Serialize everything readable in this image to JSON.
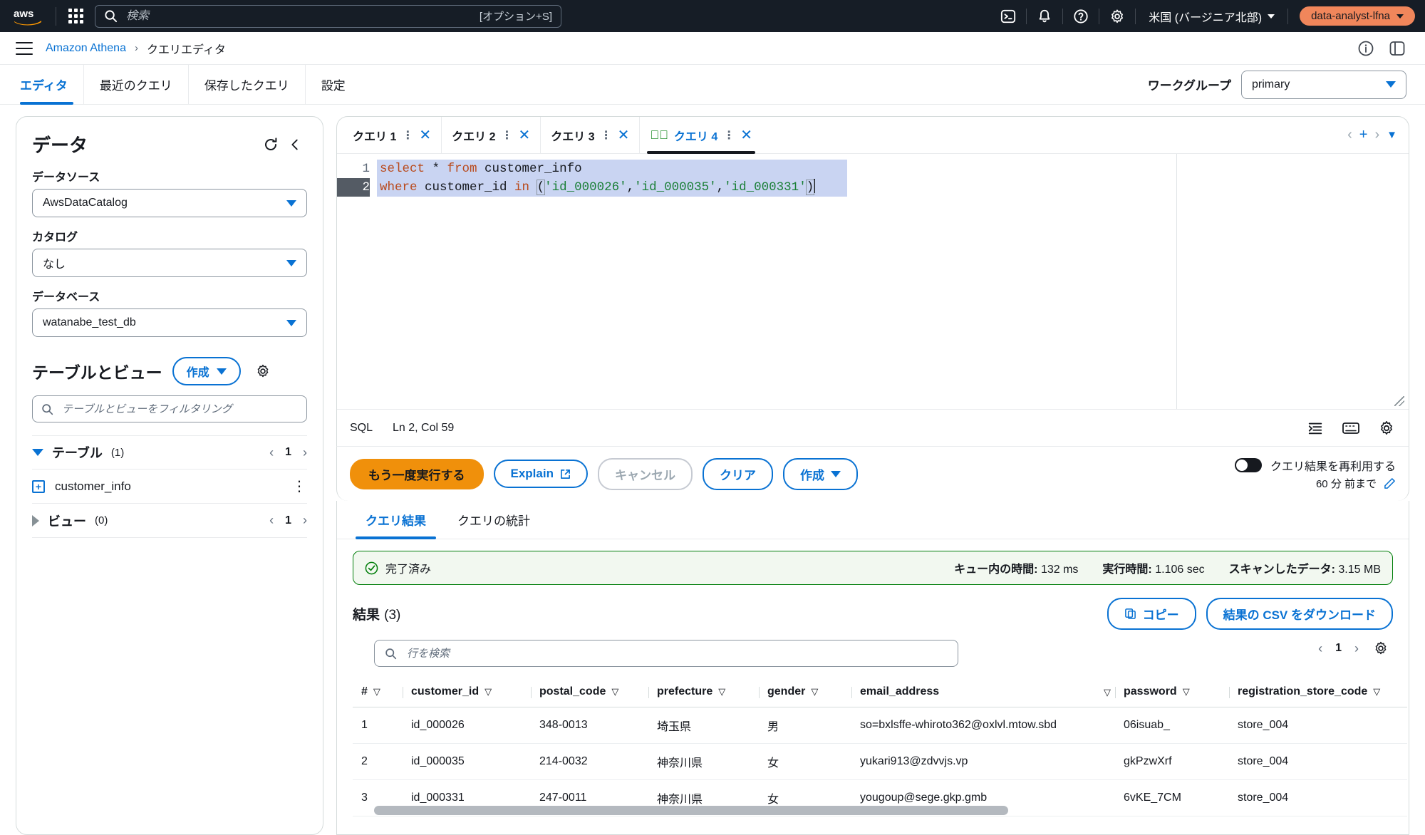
{
  "top_nav": {
    "logo": "aws-logo",
    "apps_icon": "apps-grid-icon",
    "search": {
      "placeholder": "検索",
      "value": "",
      "hint": "[オプション+S]",
      "icon": "search-icon"
    },
    "icons": [
      "cloudshell-icon",
      "bell-icon",
      "help-icon",
      "settings-icon"
    ],
    "region": "米国 (バージニア北部)",
    "account": "data-analyst-lfna"
  },
  "breadcrumb": {
    "menu_icon": "hamburger-menu-icon",
    "service": "Amazon Athena",
    "separator": "›",
    "current": "クエリエディタ",
    "right_icons": [
      "info-icon",
      "feedback-icon"
    ]
  },
  "main_tabs": [
    {
      "label": "エディタ",
      "active": true
    },
    {
      "label": "最近のクエリ",
      "active": false
    },
    {
      "label": "保存したクエリ",
      "active": false
    },
    {
      "label": "設定",
      "active": false
    }
  ],
  "workgroup": {
    "label": "ワークグループ",
    "value": "primary"
  },
  "data_panel": {
    "title": "データ",
    "refresh_icon": "refresh-icon",
    "collapse_icon": "chevron-left-icon",
    "datasource_label": "データソース",
    "datasource_value": "AwsDataCatalog",
    "catalog_label": "カタログ",
    "catalog_value": "なし",
    "database_label": "データベース",
    "database_value": "watanabe_test_db",
    "tables_views_title": "テーブルとビュー",
    "create_button": "作成",
    "settings_icon": "gear-icon",
    "filter_placeholder": "テーブルとビューをフィルタリング",
    "filter_value": "",
    "tables_group": {
      "label": "テーブル",
      "count": "(1)",
      "page": "1"
    },
    "tables": [
      {
        "name": "customer_info"
      }
    ],
    "views_group": {
      "label": "ビュー",
      "count": "(0)",
      "page": "1"
    }
  },
  "query_tabs": [
    {
      "label": "クエリ 1",
      "active": false,
      "status": ""
    },
    {
      "label": "クエリ 2",
      "active": false,
      "status": ""
    },
    {
      "label": "クエリ 3",
      "active": false,
      "status": ""
    },
    {
      "label": "クエリ 4",
      "active": true,
      "status": "success"
    }
  ],
  "query_tabs_controls": {
    "add": "+",
    "left_paren": "‹",
    "right_paren": "›",
    "menu": "▼"
  },
  "editor": {
    "lines": [
      {
        "no": "1",
        "tokens": [
          {
            "t": "select ",
            "c": "kw"
          },
          {
            "t": "* ",
            "c": "plain"
          },
          {
            "t": "from ",
            "c": "kw"
          },
          {
            "t": "customer_info",
            "c": "plain"
          }
        ]
      },
      {
        "no": "2",
        "tokens": [
          {
            "t": "where ",
            "c": "kw"
          },
          {
            "t": "customer_id ",
            "c": "plain"
          },
          {
            "t": "in ",
            "c": "kw"
          },
          {
            "t": "(",
            "c": "paren"
          },
          {
            "t": "'id_000026'",
            "c": "str"
          },
          {
            "t": ",",
            "c": "plain"
          },
          {
            "t": "'id_000035'",
            "c": "str"
          },
          {
            "t": ",",
            "c": "plain"
          },
          {
            "t": "'id_000331'",
            "c": "str"
          },
          {
            "t": ")",
            "c": "paren"
          }
        ]
      }
    ],
    "full_text": "select * from customer_info\nwhere customer_id in ('id_000026','id_000035','id_000331')",
    "status_lang": "SQL",
    "status_pos": "Ln 2, Col 59",
    "status_icons": [
      "format-icon",
      "keyboard-icon",
      "editor-settings-icon"
    ]
  },
  "actions": {
    "run_again": "もう一度実行する",
    "explain": "Explain",
    "explain_icon": "external-link-icon",
    "cancel": "キャンセル",
    "clear": "クリア",
    "create": "作成",
    "reuse_label": "クエリ結果を再利用する",
    "reuse_sub": "60 分 前まで",
    "reuse_edit_icon": "pencil-icon",
    "reuse_enabled": false
  },
  "result_tabs": [
    {
      "label": "クエリ結果",
      "active": true
    },
    {
      "label": "クエリの統計",
      "active": false
    }
  ],
  "status_alert": {
    "icon": "check-circle-icon",
    "text": "完了済み",
    "metrics": [
      {
        "label": "キュー内の時間:",
        "value": "132 ms"
      },
      {
        "label": "実行時間:",
        "value": "1.106 sec"
      },
      {
        "label": "スキャンしたデータ:",
        "value": "3.15 MB"
      }
    ]
  },
  "results": {
    "title": "結果",
    "count": "(3)",
    "copy_button": "コピー",
    "copy_icon": "copy-icon",
    "download_button": "結果の CSV をダウンロード",
    "search_placeholder": "行を検索",
    "search_value": "",
    "page": "1",
    "prev_icon": "chevron-left-icon",
    "next_icon": "chevron-right-icon",
    "settings_icon": "gear-icon",
    "columns": [
      "#",
      "customer_id",
      "postal_code",
      "prefecture",
      "gender",
      "email_address",
      "password",
      "registration_store_code"
    ],
    "rows": [
      {
        "num": "1",
        "customer_id": "id_000026",
        "postal_code": "348-0013",
        "prefecture": "埼玉県",
        "gender": "男",
        "email_address": "so=bxlsffe-whiroto362@oxlvl.mtow.sbd",
        "password": "06isuab_",
        "registration_store_code": "store_004"
      },
      {
        "num": "2",
        "customer_id": "id_000035",
        "postal_code": "214-0032",
        "prefecture": "神奈川県",
        "gender": "女",
        "email_address": "yukari913@zdvvjs.vp",
        "password": "gkPzwXrf",
        "registration_store_code": "store_004"
      },
      {
        "num": "3",
        "customer_id": "id_000331",
        "postal_code": "247-0011",
        "prefecture": "神奈川県",
        "gender": "女",
        "email_address": "yougoup@sege.gkp.gmb",
        "password": "6vKE_7CM",
        "registration_store_code": "store_004"
      }
    ]
  },
  "colors": {
    "nav_bg": "#161d26",
    "accent_blue": "#0972d3",
    "primary_orange": "#f0900b",
    "account_badge": "#f0865b",
    "success_green": "#037f0c"
  }
}
